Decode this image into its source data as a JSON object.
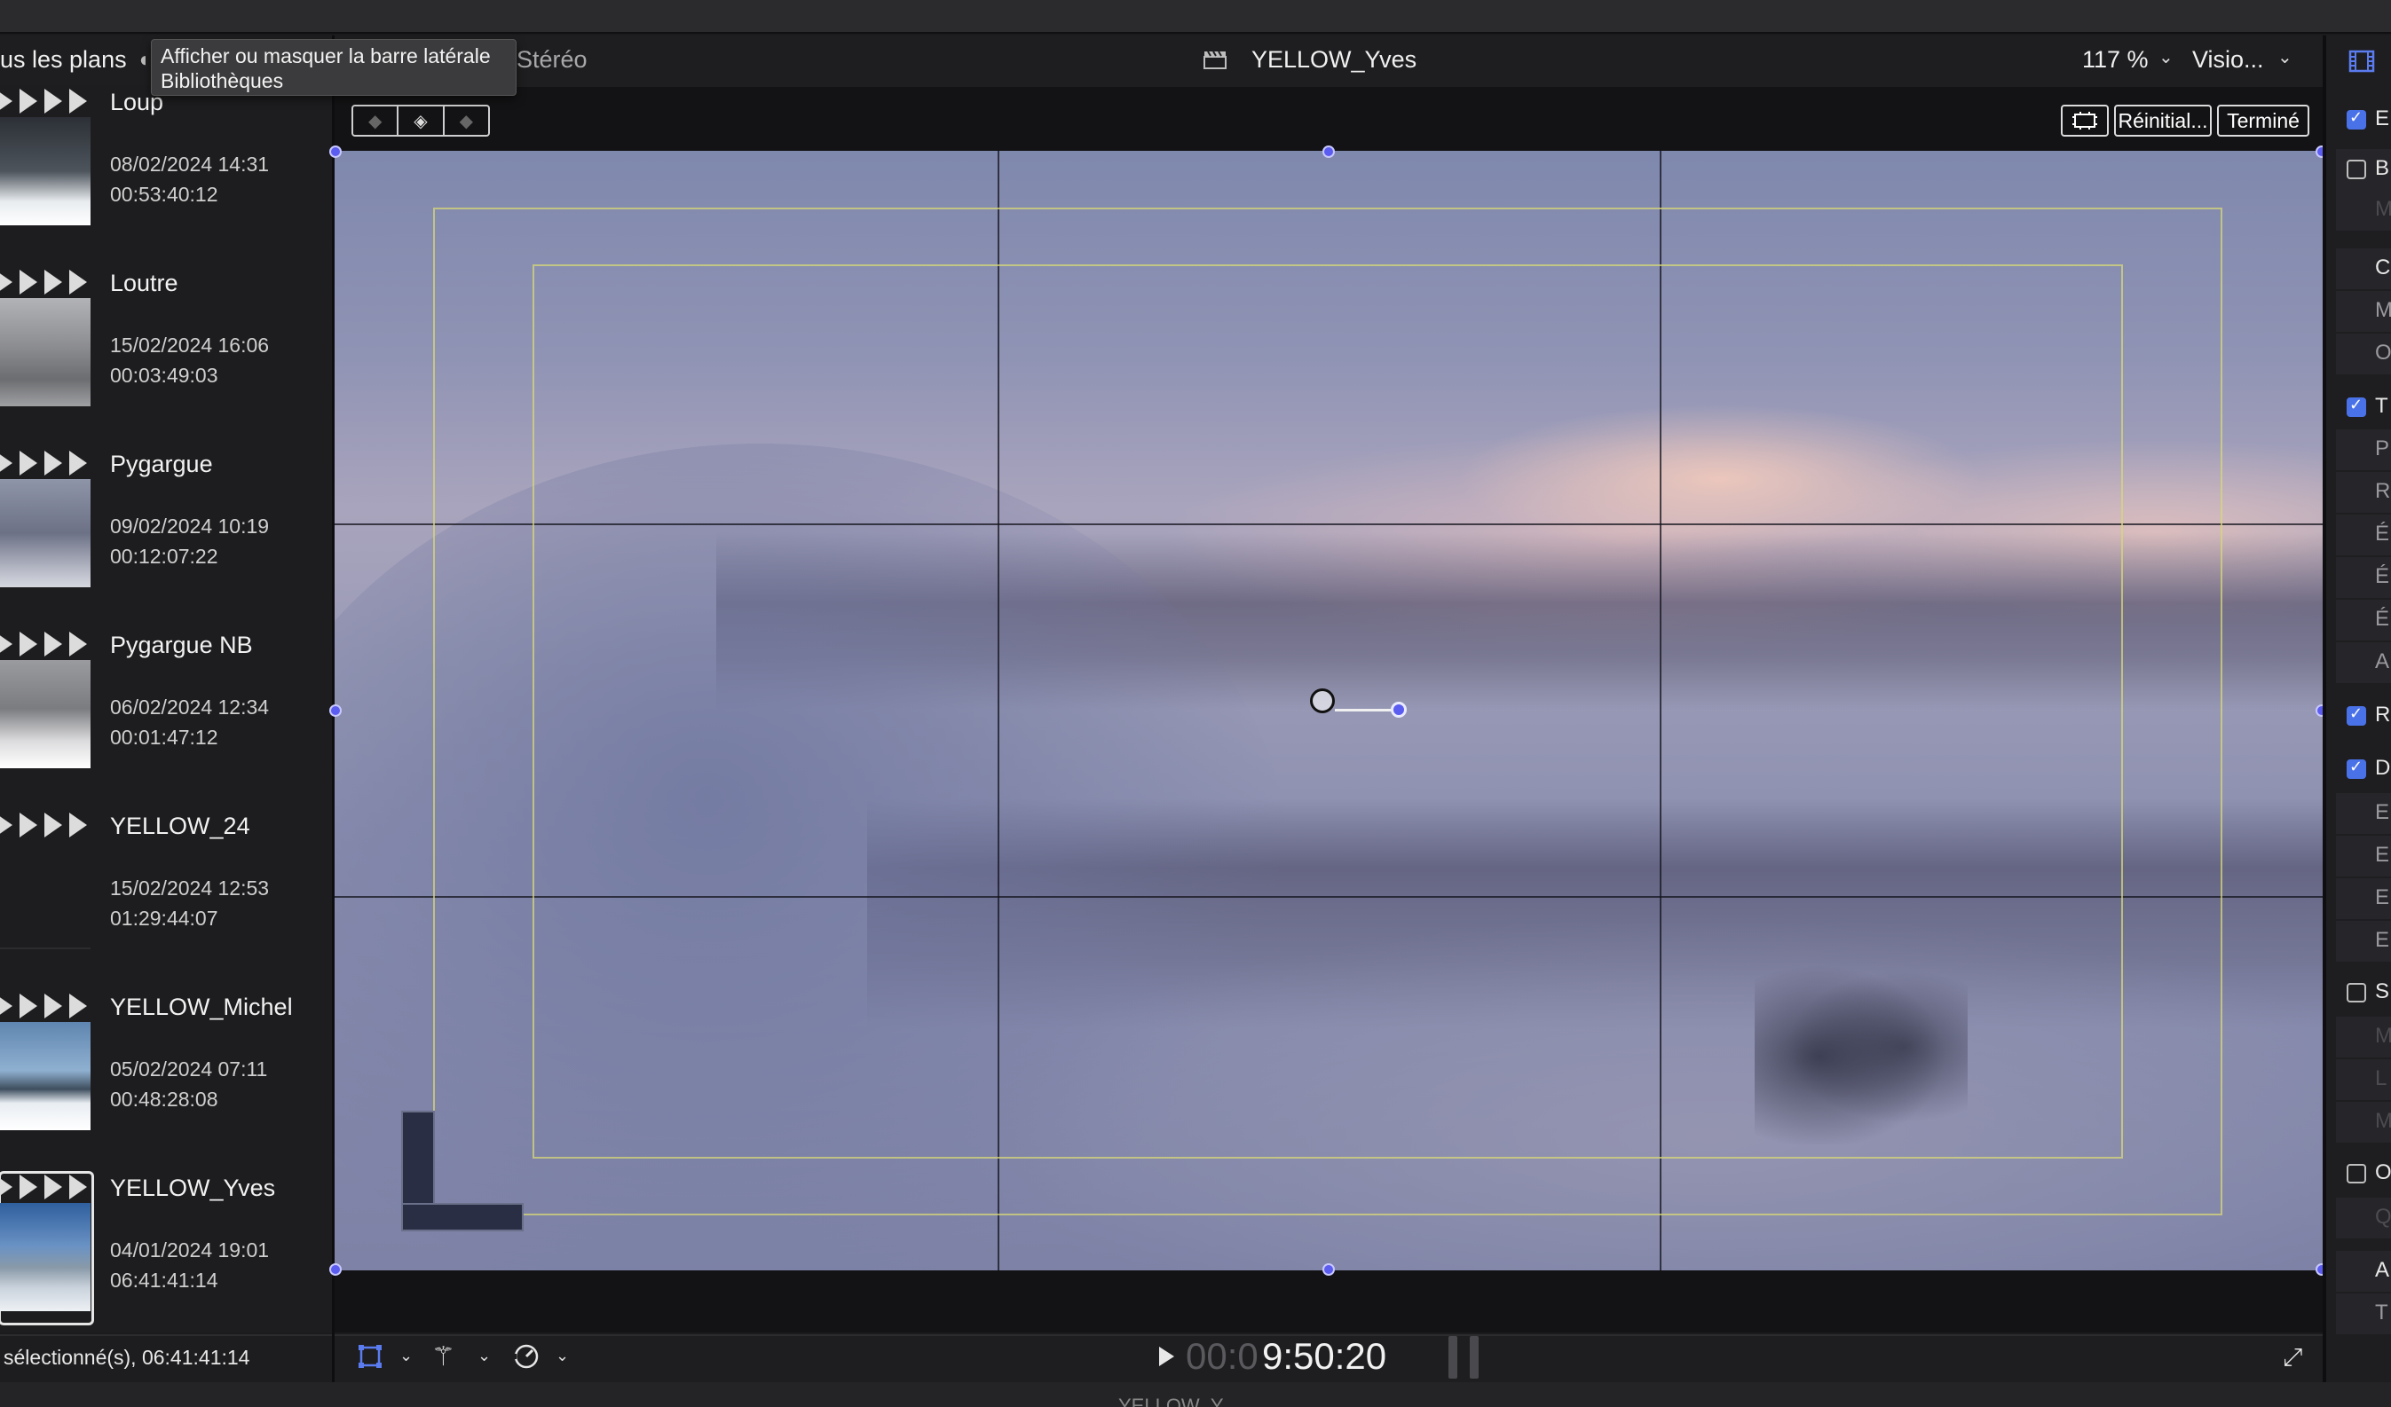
{
  "browser": {
    "filter_label": "us les plans",
    "tooltip_line1": "Afficher ou masquer la barre latérale",
    "tooltip_line2": "Bibliothèques",
    "clips": [
      {
        "name": "Loup",
        "date": "08/02/2024 14:31",
        "duration": "00:53:40:12",
        "thumb": [
          "#3a3f47",
          "#ffffff"
        ]
      },
      {
        "name": "Loutre",
        "date": "15/02/2024 16:06",
        "duration": "00:03:49:03",
        "thumb": [
          "#9a9b9e",
          "#6d6e70"
        ]
      },
      {
        "name": "Pygargue",
        "date": "09/02/2024 10:19",
        "duration": "00:12:07:22",
        "thumb": [
          "#7b7f93",
          "#c9cbd4"
        ]
      },
      {
        "name": "Pygargue NB",
        "date": "06/02/2024 12:34",
        "duration": "00:01:47:12",
        "thumb": [
          "#8f9094",
          "#f2f2f2"
        ]
      },
      {
        "name": "YELLOW_24",
        "date": "15/02/2024 12:53",
        "duration": "01:29:44:07",
        "thumb": [
          "#1d1d1f",
          "#1d1d1f"
        ]
      },
      {
        "name": "YELLOW_Michel",
        "date": "05/02/2024 07:11",
        "duration": "00:48:28:08",
        "thumb": [
          "#6f93b8",
          "#e9edf3"
        ]
      },
      {
        "name": "YELLOW_Yves",
        "date": "04/01/2024 19:01",
        "duration": "06:41:41:14",
        "thumb": [
          "#3e6aa0",
          "#d7dde6"
        ]
      }
    ],
    "status": "sélectionné(s), 06:41:41:14"
  },
  "viewer": {
    "audio_label": "Stéréo",
    "title": "YELLOW_Yves",
    "zoom": "117 %",
    "view_menu": "Visio...",
    "reset_label": "Réinitial...",
    "done_label": "Terminé",
    "timecode_dim": "00:0",
    "timecode_main": "9:50:20",
    "bottom_text": "YELLOW_Y..."
  },
  "inspector": {
    "letters": [
      "E",
      "B",
      "M",
      "C",
      "M",
      "O",
      "T",
      "P",
      "R",
      "É",
      "É",
      "É",
      "A",
      "R",
      "D",
      "E",
      "E",
      "E",
      "E",
      "S",
      "M",
      "L",
      "M",
      "O",
      "Q",
      "A",
      "T"
    ]
  },
  "colors": {
    "accent": "#5b5cf0",
    "checkbox_on": "#4a72e8",
    "safe_zone": "#d7d778"
  },
  "icons": [
    "sidebar-toggle-icon",
    "clapper-icon",
    "chevron-down-icon",
    "keyframe-prev-icon",
    "keyframe-add-icon",
    "keyframe-next-icon",
    "crop-icon",
    "transform-icon",
    "magic-wand-icon",
    "speed-icon",
    "play-icon",
    "fullscreen-icon",
    "inspector-video-icon"
  ]
}
